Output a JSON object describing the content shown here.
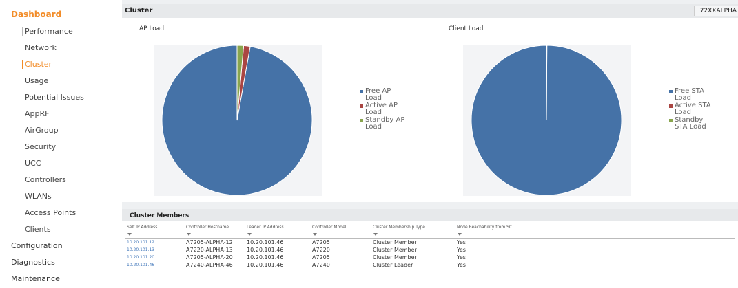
{
  "sidebar": {
    "top_item": "Dashboard",
    "sub_items": [
      {
        "label": "Performance",
        "state": "marker"
      },
      {
        "label": "Network",
        "state": ""
      },
      {
        "label": "Cluster",
        "state": "active"
      },
      {
        "label": "Usage",
        "state": ""
      },
      {
        "label": "Potential Issues",
        "state": ""
      },
      {
        "label": "AppRF",
        "state": ""
      },
      {
        "label": "AirGroup",
        "state": ""
      },
      {
        "label": "Security",
        "state": ""
      },
      {
        "label": "UCC",
        "state": ""
      },
      {
        "label": "Controllers",
        "state": ""
      },
      {
        "label": "WLANs",
        "state": ""
      },
      {
        "label": "Access Points",
        "state": ""
      },
      {
        "label": "Clients",
        "state": ""
      }
    ],
    "main_items": [
      {
        "label": "Configuration"
      },
      {
        "label": "Diagnostics"
      },
      {
        "label": "Maintenance"
      }
    ]
  },
  "cluster": {
    "title": "Cluster",
    "hostname": "72XXALPHA"
  },
  "chart_data": [
    {
      "type": "pie",
      "title": "AP Load",
      "categories": [
        "Free AP Load",
        "Active AP Load",
        "Standby AP Load"
      ],
      "legend_lines": [
        [
          "Free AP",
          "Load"
        ],
        [
          "Active AP",
          "Load"
        ],
        [
          "Standby AP",
          "Load"
        ]
      ],
      "values": [
        97.2,
        1.4,
        1.4
      ],
      "colors": [
        "#4572a7",
        "#aa4643",
        "#89a54e"
      ],
      "legend_position": "right"
    },
    {
      "type": "pie",
      "title": "Client Load",
      "categories": [
        "Free STA Load",
        "Active STA Load",
        "Standby STA Load"
      ],
      "legend_lines": [
        [
          "Free STA",
          "Load"
        ],
        [
          "Active STA",
          "Load"
        ],
        [
          "Standby",
          "STA Load"
        ]
      ],
      "values": [
        99.9,
        0.1,
        0
      ],
      "colors": [
        "#4572a7",
        "#aa4643",
        "#89a54e"
      ],
      "legend_position": "right"
    }
  ],
  "members": {
    "title": "Cluster Members",
    "columns": [
      "Self IP Address",
      "Controller Hostname",
      "Leader IP Address",
      "Controller Model",
      "Cluster Membership Type",
      "Node Reachability from SC"
    ],
    "rows": [
      [
        "10.20.101.12",
        "A7205-ALPHA-12",
        "10.20.101.46",
        "A7205",
        "Cluster Member",
        "Yes"
      ],
      [
        "10.20.101.13",
        "A7220-ALPHA-13",
        "10.20.101.46",
        "A7220",
        "Cluster Member",
        "Yes"
      ],
      [
        "10.20.101.20",
        "A7205-ALPHA-20",
        "10.20.101.46",
        "A7205",
        "Cluster Member",
        "Yes"
      ],
      [
        "10.20.101.46",
        "A7240-ALPHA-46",
        "10.20.101.46",
        "A7240",
        "Cluster Leader",
        "Yes"
      ]
    ]
  }
}
